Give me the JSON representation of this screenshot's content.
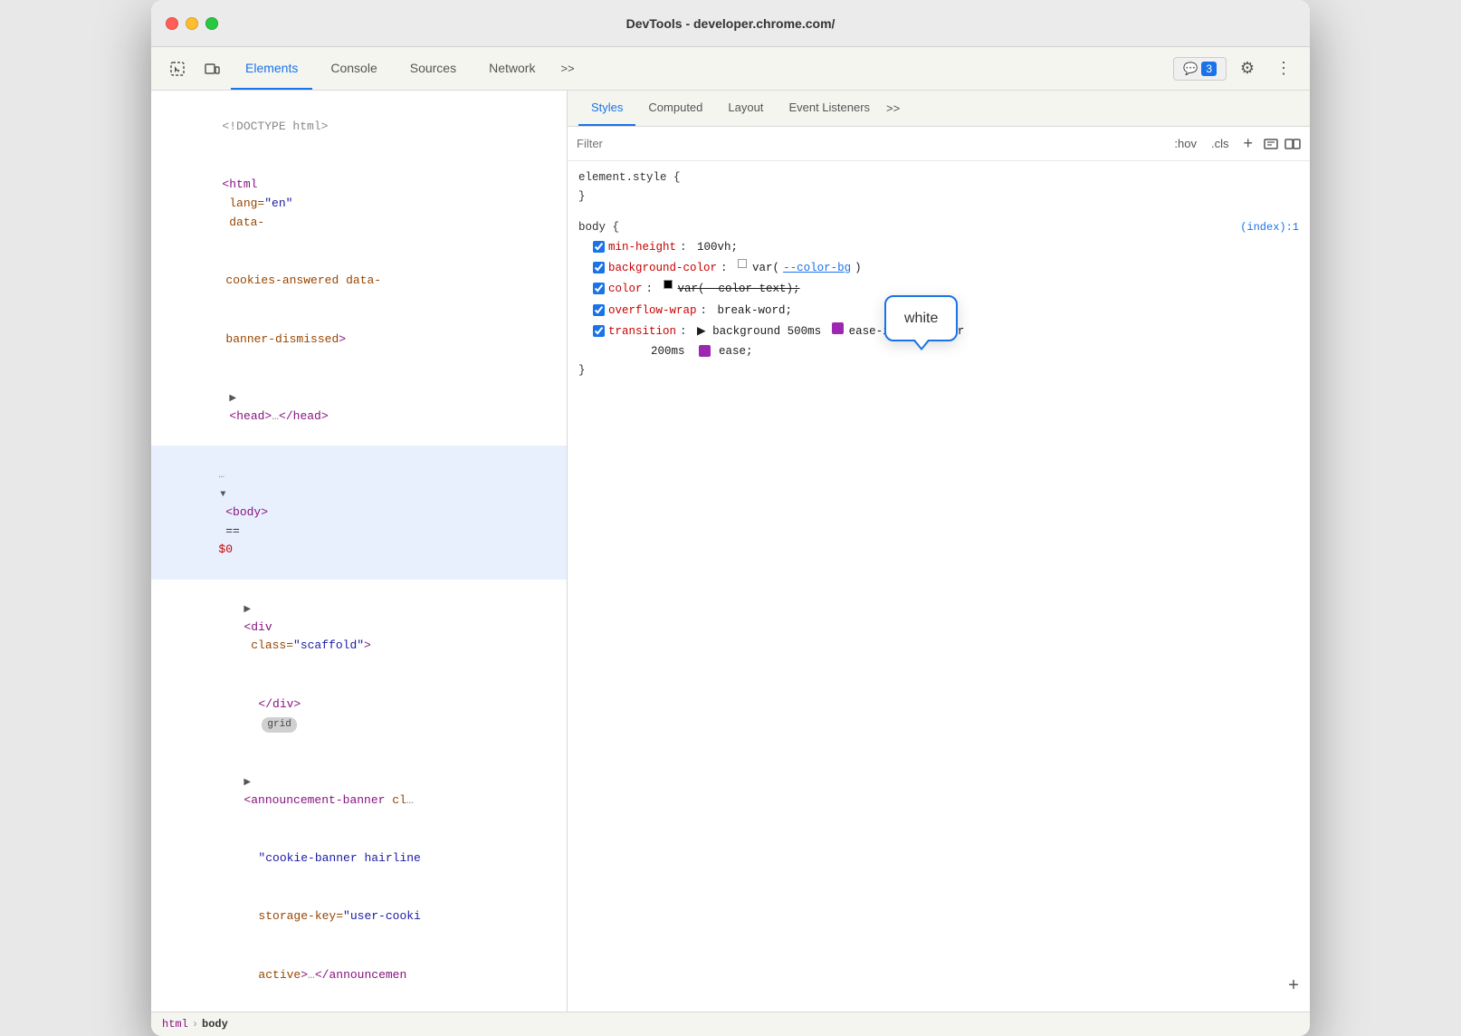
{
  "window": {
    "title": "DevTools - developer.chrome.com/"
  },
  "toolbar": {
    "tabs": [
      {
        "id": "elements",
        "label": "Elements",
        "active": true
      },
      {
        "id": "console",
        "label": "Console",
        "active": false
      },
      {
        "id": "sources",
        "label": "Sources",
        "active": false
      },
      {
        "id": "network",
        "label": "Network",
        "active": false
      }
    ],
    "more_label": ">>",
    "badge_count": "3",
    "settings_icon": "⚙",
    "more_icon": "⋮"
  },
  "elements_panel": {
    "lines": [
      {
        "text": "<!DOCTYPE html>",
        "indent": 0,
        "type": "comment"
      },
      {
        "text": "<html lang=\"en\" data-cookies-answered data-banner-dismissed>",
        "indent": 0,
        "type": "html",
        "multiline": true
      },
      {
        "text": "<head>…</head>",
        "indent": 1,
        "type": "collapsible"
      },
      {
        "text": "<body> == $0",
        "indent": 0,
        "type": "selected",
        "has_triangle": true,
        "expanded": true
      },
      {
        "text": "<div class=\"scaffold\">",
        "indent": 2,
        "type": "collapsible"
      },
      {
        "text": "</div>",
        "indent": 3,
        "type": "html"
      },
      {
        "text": "<announcement-banner cl…",
        "indent": 2,
        "type": "collapsible_long"
      },
      {
        "text": "\"cookie-banner hairline storage-key=\"user-cooki active>…</announcement",
        "indent": 3,
        "type": "continuation"
      }
    ]
  },
  "breadcrumb": {
    "items": [
      "html",
      "body"
    ]
  },
  "styles_panel": {
    "tabs": [
      {
        "label": "Styles",
        "active": true
      },
      {
        "label": "Computed",
        "active": false
      },
      {
        "label": "Layout",
        "active": false
      },
      {
        "label": "Event Listeners",
        "active": false
      },
      {
        "label": ">>",
        "active": false
      }
    ],
    "filter_placeholder": "Filter",
    "filter_actions": [
      ":hov",
      ".cls",
      "+"
    ],
    "sections": [
      {
        "selector": "element.style {",
        "close": "}",
        "rules": []
      },
      {
        "selector": "body {",
        "close": "}",
        "source": "(index):1",
        "rules": [
          {
            "checked": true,
            "prop": "min-height",
            "value": "100vh;"
          },
          {
            "checked": true,
            "prop": "background-color",
            "value_parts": [
              {
                "type": "swatch",
                "color": "white"
              },
              {
                "type": "var",
                "text": "var("
              }
            ],
            "raw": "var(--color-bg)"
          },
          {
            "checked": true,
            "prop": "color",
            "value_parts": [
              {
                "type": "swatch",
                "color": "black"
              },
              {
                "type": "var-strikethrough",
                "text": "var(--color-text);"
              }
            ]
          },
          {
            "checked": true,
            "prop": "overflow-wrap",
            "value": "break-word;"
          },
          {
            "checked": true,
            "prop": "transition",
            "value_complex": true
          }
        ]
      }
    ],
    "tooltip": {
      "text": "white",
      "visible": true
    },
    "add_rule_label": "+"
  }
}
